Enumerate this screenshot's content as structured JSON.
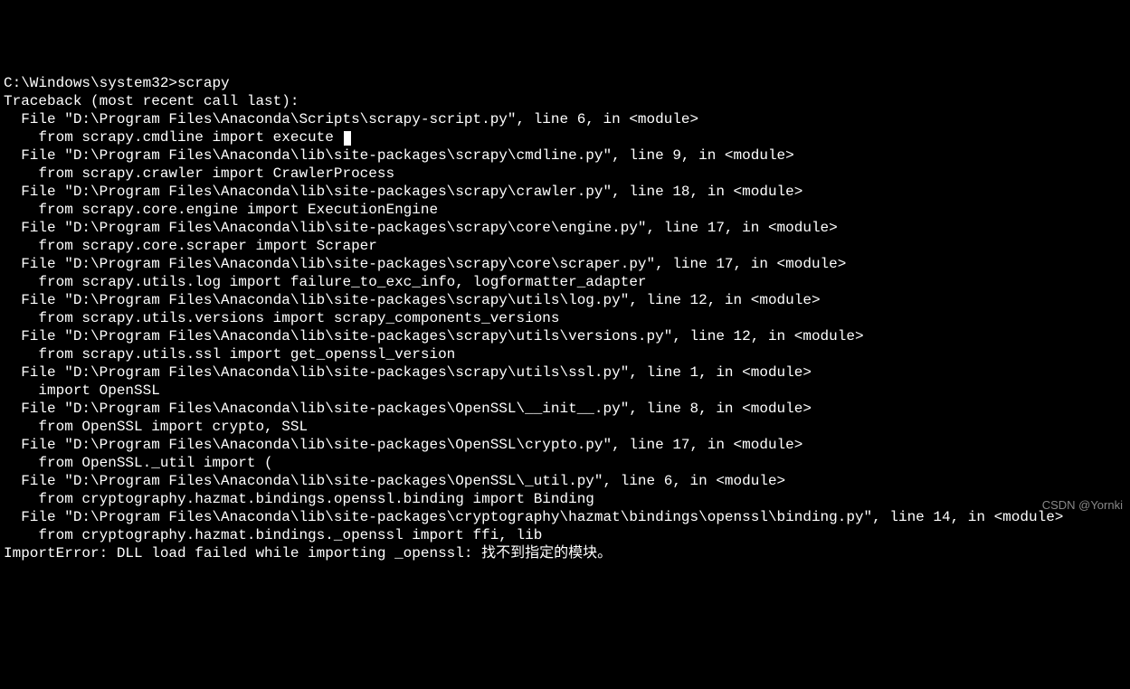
{
  "terminal": {
    "lines": [
      "C:\\Windows\\system32>scrapy",
      "Traceback (most recent call last):",
      "  File \"D:\\Program Files\\Anaconda\\Scripts\\scrapy-script.py\", line 6, in <module>",
      "    from scrapy.cmdline import execute ",
      "  File \"D:\\Program Files\\Anaconda\\lib\\site-packages\\scrapy\\cmdline.py\", line 9, in <module>",
      "    from scrapy.crawler import CrawlerProcess",
      "  File \"D:\\Program Files\\Anaconda\\lib\\site-packages\\scrapy\\crawler.py\", line 18, in <module>",
      "    from scrapy.core.engine import ExecutionEngine",
      "  File \"D:\\Program Files\\Anaconda\\lib\\site-packages\\scrapy\\core\\engine.py\", line 17, in <module>",
      "    from scrapy.core.scraper import Scraper",
      "  File \"D:\\Program Files\\Anaconda\\lib\\site-packages\\scrapy\\core\\scraper.py\", line 17, in <module>",
      "    from scrapy.utils.log import failure_to_exc_info, logformatter_adapter",
      "  File \"D:\\Program Files\\Anaconda\\lib\\site-packages\\scrapy\\utils\\log.py\", line 12, in <module>",
      "    from scrapy.utils.versions import scrapy_components_versions",
      "  File \"D:\\Program Files\\Anaconda\\lib\\site-packages\\scrapy\\utils\\versions.py\", line 12, in <module>",
      "    from scrapy.utils.ssl import get_openssl_version",
      "  File \"D:\\Program Files\\Anaconda\\lib\\site-packages\\scrapy\\utils\\ssl.py\", line 1, in <module>",
      "    import OpenSSL",
      "  File \"D:\\Program Files\\Anaconda\\lib\\site-packages\\OpenSSL\\__init__.py\", line 8, in <module>",
      "    from OpenSSL import crypto, SSL",
      "  File \"D:\\Program Files\\Anaconda\\lib\\site-packages\\OpenSSL\\crypto.py\", line 17, in <module>",
      "    from OpenSSL._util import (",
      "  File \"D:\\Program Files\\Anaconda\\lib\\site-packages\\OpenSSL\\_util.py\", line 6, in <module>",
      "    from cryptography.hazmat.bindings.openssl.binding import Binding",
      "  File \"D:\\Program Files\\Anaconda\\lib\\site-packages\\cryptography\\hazmat\\bindings\\openssl\\binding.py\", line 14, in <module>",
      "    from cryptography.hazmat.bindings._openssl import ffi, lib",
      "ImportError: DLL load failed while importing _openssl: 找不到指定的模块。"
    ],
    "cursor_line": 3
  },
  "watermark": "CSDN @Yornki"
}
